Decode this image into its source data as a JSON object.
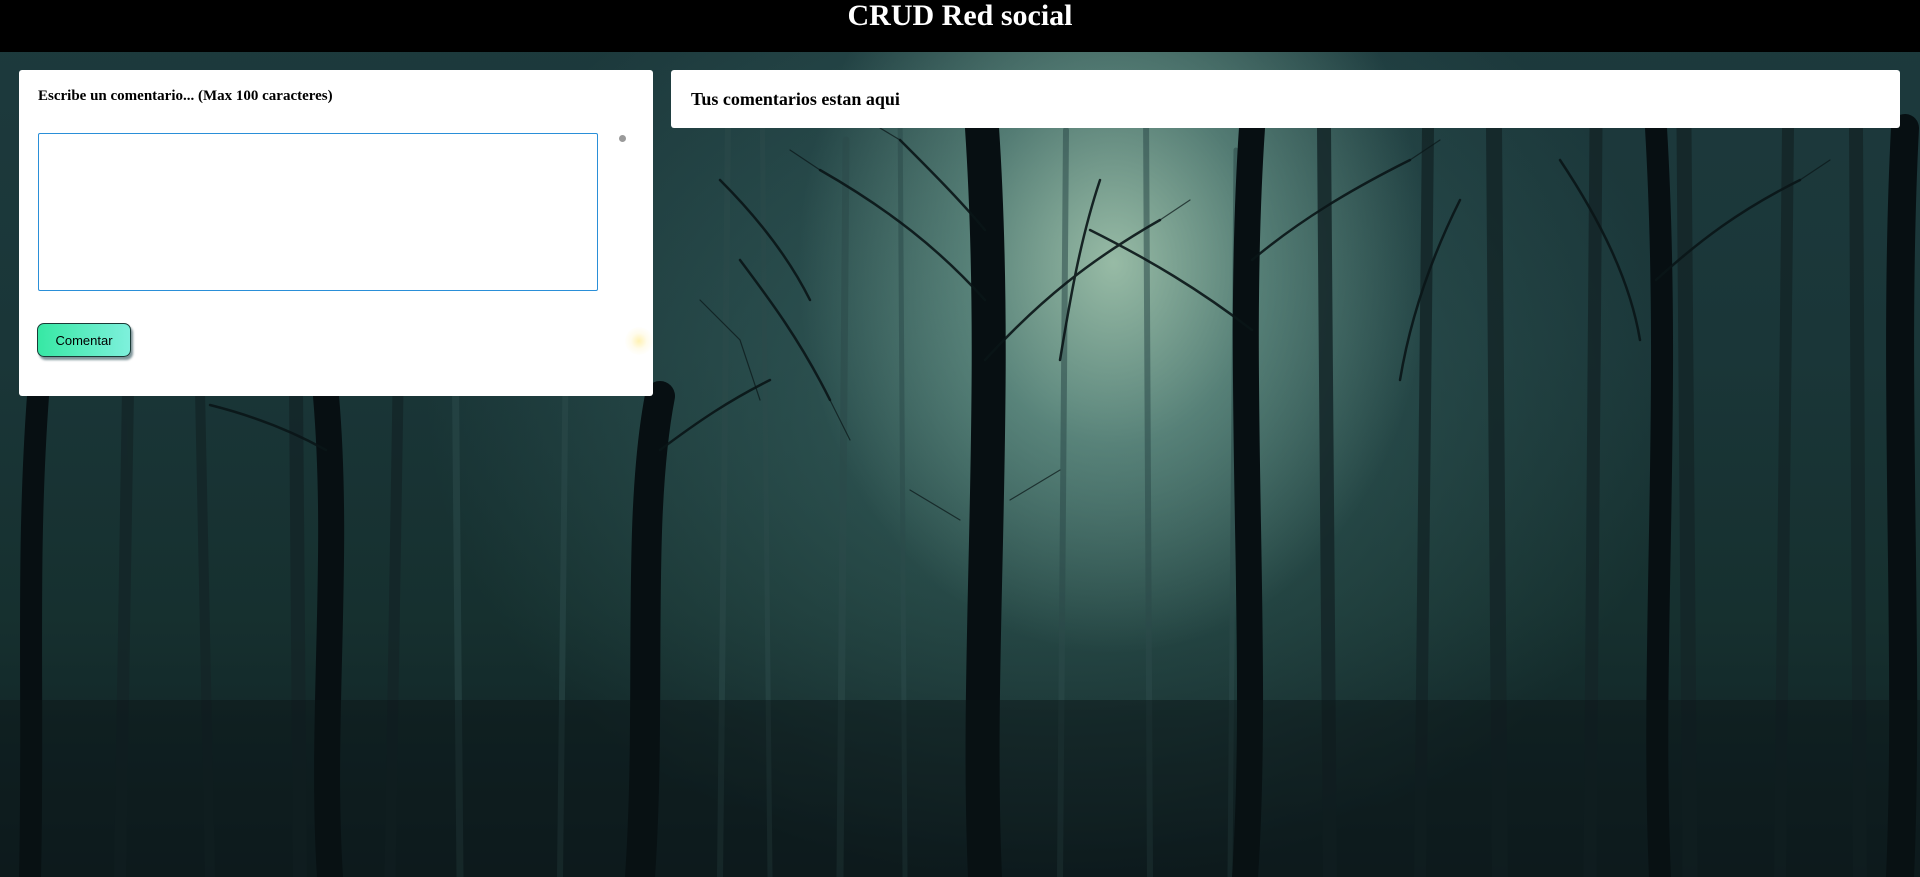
{
  "header": {
    "title": "CRUD Red social"
  },
  "comment_form": {
    "label": "Escribe un comentario... (Max 100 caracteres)",
    "textarea_value": "",
    "textarea_placeholder": "",
    "submit_label": "Comentar"
  },
  "comments_panel": {
    "title": "Tus comentarios estan aqui"
  },
  "colors": {
    "header_bg": "#000000",
    "button_gradient_start": "#37e8a4",
    "button_gradient_end": "#7ef0dc",
    "textarea_border": "#2a8fd8"
  }
}
